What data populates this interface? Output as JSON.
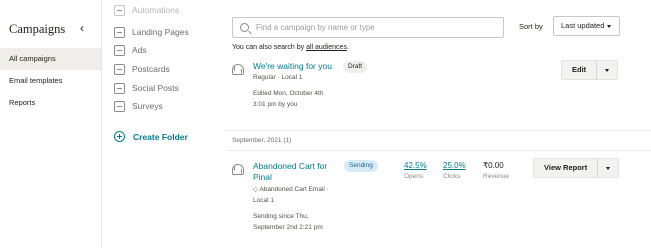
{
  "sidebar": {
    "title": "Campaigns",
    "collapse_glyph": "‹",
    "items": [
      {
        "label": "All campaigns",
        "active": true
      },
      {
        "label": "Email templates",
        "active": false
      },
      {
        "label": "Reports",
        "active": false
      }
    ]
  },
  "folders": {
    "items": [
      {
        "label": "Automations",
        "icon": "automation-icon"
      },
      {
        "label": "Landing Pages",
        "icon": "landing-page-icon"
      },
      {
        "label": "Ads",
        "icon": "ads-icon"
      },
      {
        "label": "Postcards",
        "icon": "postcard-icon"
      },
      {
        "label": "Social Posts",
        "icon": "social-post-icon"
      },
      {
        "label": "Surveys",
        "icon": "survey-icon"
      }
    ],
    "create_label": "Create Folder"
  },
  "search": {
    "placeholder": "Find a campaign by name or type",
    "value": ""
  },
  "sort": {
    "label": "Sort by",
    "selected": "Last updated"
  },
  "audience_hint": {
    "prefix": "You can also search by ",
    "link": "all audiences",
    "suffix": "."
  },
  "draft_campaign": {
    "title": "We're waiting for you",
    "badge": "Draft",
    "type_line": "Regular · Local 1",
    "edited_line1": "Edited Mon, October 4th",
    "edited_line2": "3:01 pm by you",
    "action_label": "Edit"
  },
  "section": {
    "heading": "September, 2021 (1)"
  },
  "sending_campaign": {
    "title_line1": "Abandoned Cart for",
    "title_line2": "Pinal",
    "badge": "Sending",
    "type_line1": "◇ Abandoned Cart Email ·",
    "type_line2": "Local 1",
    "since_line1": "Sending since Thu,",
    "since_line2": "September 2nd 2:21 pm",
    "opens_value": "42.5%",
    "opens_label": "Opens",
    "clicks_value": "25.0%",
    "clicks_label": "Clicks",
    "revenue_value": "₹0.00",
    "revenue_label": "Revenue",
    "action_label": "View Report"
  },
  "colors": {
    "accent": "#007c89",
    "active_bg": "#efeeea",
    "sending_badge_bg": "#d7ebf7"
  }
}
